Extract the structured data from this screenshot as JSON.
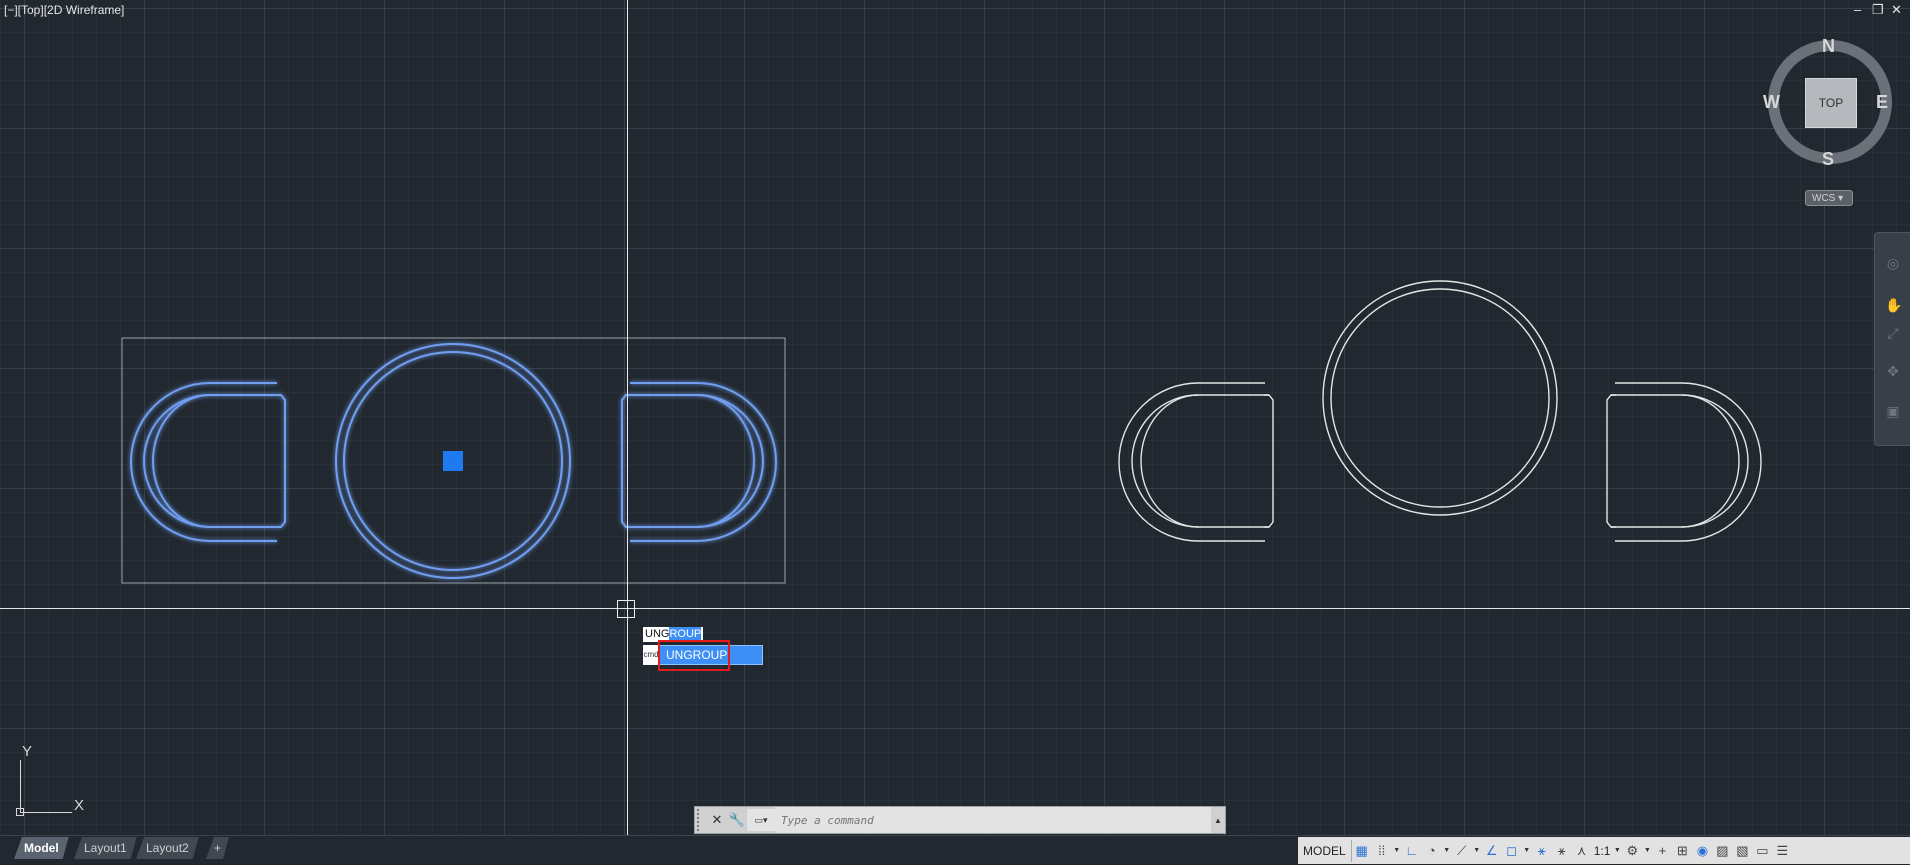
{
  "viewport": {
    "label": "[−][Top][2D Wireframe]"
  },
  "window_controls": {
    "minimize": "‒",
    "restore": "❐",
    "close": "✕"
  },
  "autocomplete": {
    "typed_prefix": "UNG",
    "completion": "ROUP",
    "suggestion": "UNGROUP",
    "side_label": "cmd"
  },
  "viewcube": {
    "top": "TOP",
    "north": "N",
    "south": "S",
    "east": "E",
    "west": "W",
    "wcs": "WCS"
  },
  "ucs": {
    "x": "X",
    "y": "Y"
  },
  "command_line": {
    "placeholder": "Type a command"
  },
  "layout_tabs": [
    {
      "label": "Model",
      "active": true
    },
    {
      "label": "Layout1",
      "active": false
    },
    {
      "label": "Layout2",
      "active": false
    }
  ],
  "add_tab": "+",
  "status_bar": {
    "model": "MODEL",
    "scale": "1:1"
  },
  "colors": {
    "accent": "#3d8ff5",
    "highlight_red": "#e21b1b",
    "canvas": "#212830"
  }
}
